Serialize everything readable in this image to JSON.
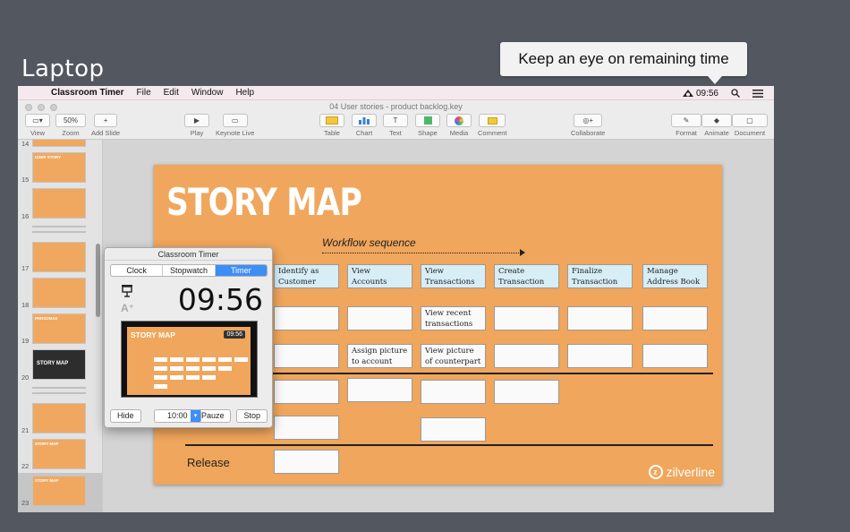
{
  "overlay": {
    "device_label": "Laptop",
    "callout": "Keep an eye on remaining time"
  },
  "menubar": {
    "app_name": "Classroom Timer",
    "menus": [
      "File",
      "Edit",
      "Window",
      "Help"
    ],
    "status_time": "09:56"
  },
  "window": {
    "document_title": "04 User stories - product backlog.key",
    "toolbar": {
      "view": "View",
      "zoom_value": "50%",
      "zoom": "Zoom",
      "add_slide": "Add Slide",
      "play": "Play",
      "keynote_live": "Keynote Live",
      "table": "Table",
      "chart": "Chart",
      "text": "Text",
      "shape": "Shape",
      "media": "Media",
      "comment": "Comment",
      "collaborate": "Collaborate",
      "format": "Format",
      "animate": "Animate",
      "document": "Document"
    }
  },
  "slides_nav": {
    "numbers": [
      "14",
      "15",
      "16",
      "17",
      "18",
      "19",
      "20",
      "21",
      "22",
      "23"
    ],
    "thumb_titles": [
      "",
      "USER STORY",
      "",
      "",
      "",
      "PERSONAS",
      "STORY MAP",
      "",
      "STORY MAP",
      "STORY MAP"
    ]
  },
  "slide": {
    "title": "STORY MAP",
    "workflow": "Workflow sequence",
    "activities": [
      "Identify as Customer",
      "View Accounts",
      "View Transactions",
      "Create Transaction",
      "Finalize Transaction",
      "Manage Address Book"
    ],
    "row2": [
      "",
      "",
      "View recent transactions",
      "",
      "",
      ""
    ],
    "row3": [
      "",
      "Assign picture to account",
      "View picture of counterpart",
      "",
      "",
      ""
    ],
    "release_label": "Release",
    "logo": "zilverline"
  },
  "timer": {
    "window_title": "Classroom Timer",
    "tabs": [
      "Clock",
      "Stopwatch",
      "Timer"
    ],
    "active_tab": "Timer",
    "remaining": "09:56",
    "preview_title": "STORY MAP",
    "preview_time": "09:56",
    "hide_label": "Hide",
    "duration_value": "10:00",
    "pause_label": "Pauze",
    "stop_label": "Stop"
  }
}
